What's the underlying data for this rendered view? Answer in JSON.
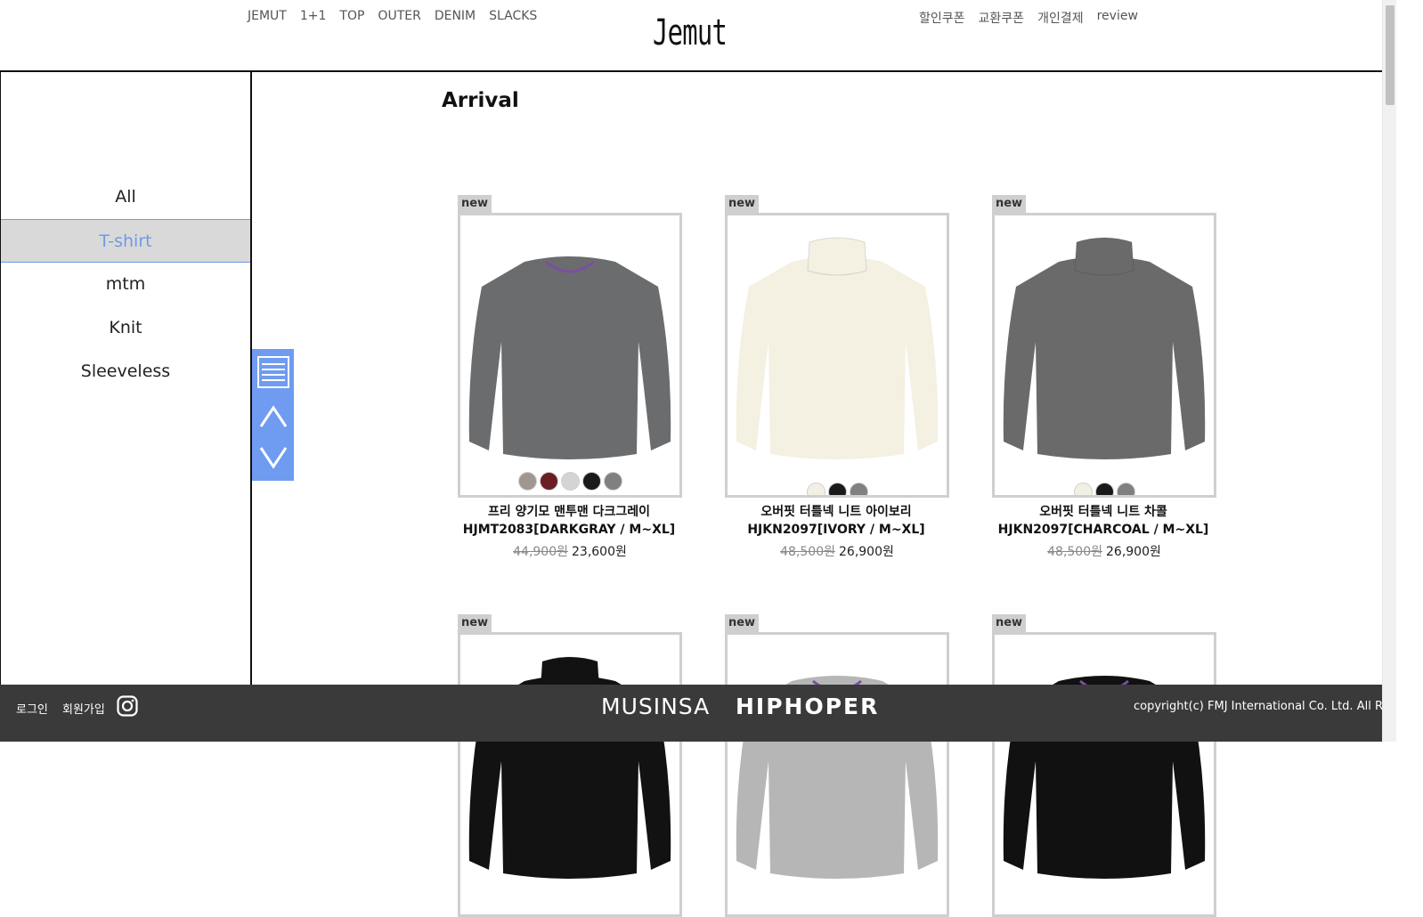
{
  "header": {
    "nav_left": [
      "JEMUT",
      "1+1",
      "TOP",
      "OUTER",
      "DENIM",
      "SLACKS"
    ],
    "logo": "Jemut",
    "nav_right": [
      "할인쿠폰",
      "교환쿠폰",
      "개인결제",
      "review"
    ]
  },
  "sidebar": {
    "items": [
      {
        "label": "All",
        "active": false
      },
      {
        "label": "T-shirt",
        "active": true
      },
      {
        "label": "mtm",
        "active": false
      },
      {
        "label": "Knit",
        "active": false
      },
      {
        "label": "Sleeveless",
        "active": false
      }
    ]
  },
  "float_controls": {
    "menu_icon": "hamburger-menu-icon",
    "up_icon": "chevron-up-icon",
    "down_icon": "chevron-down-icon"
  },
  "main": {
    "title": "Arrival",
    "products": [
      {
        "badge": "new",
        "name_line1": "프리 양기모 맨투맨 다크그레이",
        "name_line2": "HJMT2083[DARKGRAY / M~XL]",
        "old_price": "44,900원",
        "price": "23,600원",
        "garment": "crewneck",
        "garment_color": "#6b6c6e",
        "swatches": [
          "#a09890",
          "#6a1f24",
          "#d4d4d4",
          "#1a1a1a",
          "#808080"
        ]
      },
      {
        "badge": "new",
        "name_line1": "오버핏 터틀넥 니트 아이보리",
        "name_line2": "HJKN2097[IVORY / M~XL]",
        "old_price": "48,500원",
        "price": "26,900원",
        "garment": "turtleneck",
        "garment_color": "#f4f0e2",
        "swatches": [
          "#f2efe4",
          "#1a1a1a",
          "#808080"
        ]
      },
      {
        "badge": "new",
        "name_line1": "오버핏 터틀넥 니트 차콜",
        "name_line2": "HJKN2097[CHARCOAL / M~XL]",
        "old_price": "48,500원",
        "price": "26,900원",
        "garment": "turtleneck",
        "garment_color": "#6a6a6a",
        "swatches": [
          "#f2efe4",
          "#1a1a1a",
          "#808080"
        ]
      },
      {
        "badge": "new",
        "name_line1": "",
        "name_line2": "",
        "old_price": "",
        "price": "",
        "garment": "turtleneck",
        "garment_color": "#121212",
        "swatches": []
      },
      {
        "badge": "new",
        "name_line1": "",
        "name_line2": "",
        "old_price": "",
        "price": "",
        "garment": "crewneck",
        "garment_color": "#b6b6b6",
        "swatches": []
      },
      {
        "badge": "new",
        "name_line1": "",
        "name_line2": "",
        "old_price": "",
        "price": "",
        "garment": "crewneck",
        "garment_color": "#111111",
        "swatches": []
      }
    ]
  },
  "footer": {
    "login": "로그인",
    "join": "회원가입",
    "instagram_icon": "instagram-icon",
    "musinsa": "MUSINSA",
    "hiphoper": "HIPHOPER",
    "copyright": "copyright(c) FMJ International Co. Ltd. All Rights Reserved."
  }
}
